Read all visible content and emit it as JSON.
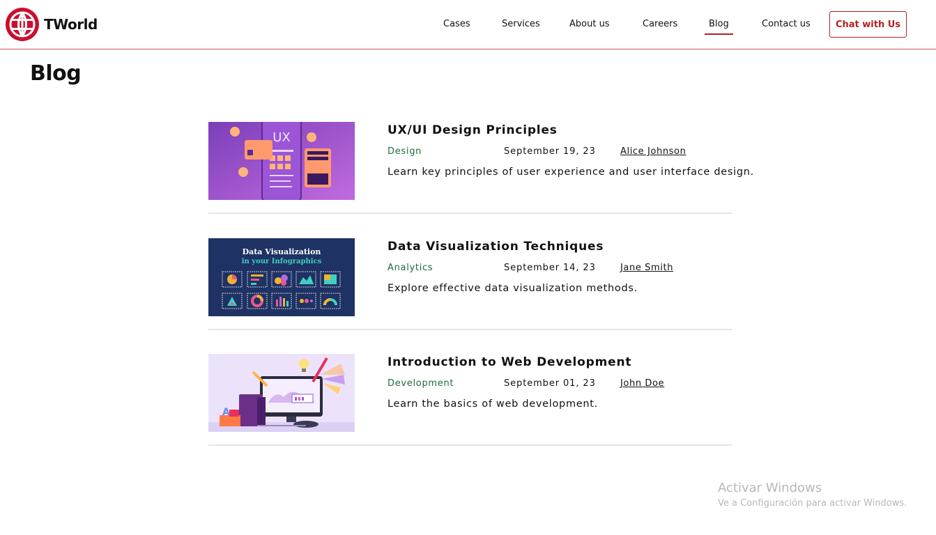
{
  "brand": {
    "name": "TWorld",
    "accent": "#b22222"
  },
  "nav": {
    "items": [
      {
        "label": "Cases",
        "active": false
      },
      {
        "label": "Services",
        "active": false
      },
      {
        "label": "About us",
        "active": false
      },
      {
        "label": "Careers",
        "active": false
      },
      {
        "label": "Blog",
        "active": true
      },
      {
        "label": "Contact us",
        "active": false
      }
    ],
    "cta_label": "Chat with Us"
  },
  "page": {
    "title": "Blog"
  },
  "posts": [
    {
      "title": "UX/UI Design Principles",
      "category": "Design",
      "date": "September 19, 23",
      "author": "Alice Johnson",
      "description": "Learn key principles of user experience and user interface design.",
      "thumb_text": "UX"
    },
    {
      "title": "Data Visualization Techniques",
      "category": "Analytics",
      "date": "September 14, 23",
      "author": "Jane Smith",
      "description": "Explore effective data visualization methods.",
      "thumb_text": "Data Visualization",
      "thumb_subtext": "in your Infographics"
    },
    {
      "title": "Introduction to Web Development",
      "category": "Development",
      "date": "September 01, 23",
      "author": "John Doe",
      "description": "Learn the basics of web development."
    }
  ],
  "watermark": {
    "title": "Activar Windows",
    "subtitle": "Ve a Configuración para activar Windows."
  }
}
